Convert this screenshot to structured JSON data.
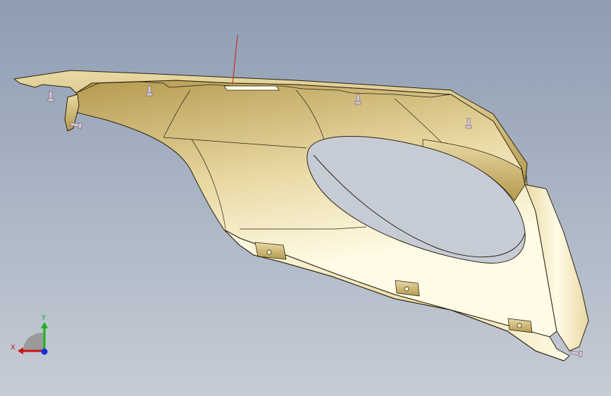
{
  "viewport": {
    "background_top": "#8e9db2",
    "background_bottom": "#c6ccd6"
  },
  "model": {
    "part_color_light": "#fffbe6",
    "part_color_mid": "#e9d9a4",
    "part_color_dark": "#b59a4f",
    "edge_color": "#2a2210",
    "fastener_color": "#d8c7d8",
    "reference_line_color": "#d11a1a"
  },
  "triad": {
    "x_label": "X",
    "y_label": "Y",
    "x_color": "#d01010",
    "y_color": "#19b219",
    "z_color": "#1a2fd8"
  }
}
